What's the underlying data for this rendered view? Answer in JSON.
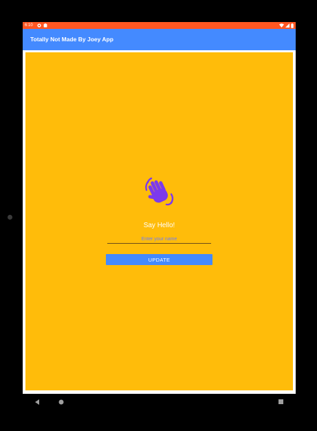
{
  "status_bar": {
    "time": "6:10",
    "background": "#ff5722",
    "left_icons": [
      "notification-icon",
      "storage-icon"
    ],
    "right_icons": [
      "wifi-icon",
      "signal-icon",
      "battery-icon"
    ]
  },
  "app_bar": {
    "title": "Totally Not Made By Joey App",
    "background": "#448aff"
  },
  "content": {
    "background": "#ffbc0a",
    "icon": "waving-hand-icon",
    "icon_color": "#7c3aed",
    "greeting": "Say Hello!",
    "name_input": {
      "value": "",
      "placeholder": "Enter your name"
    },
    "update_button_label": "UPDATE"
  },
  "nav_bar": {
    "items": [
      "back-icon",
      "home-icon",
      "recents-icon"
    ]
  }
}
